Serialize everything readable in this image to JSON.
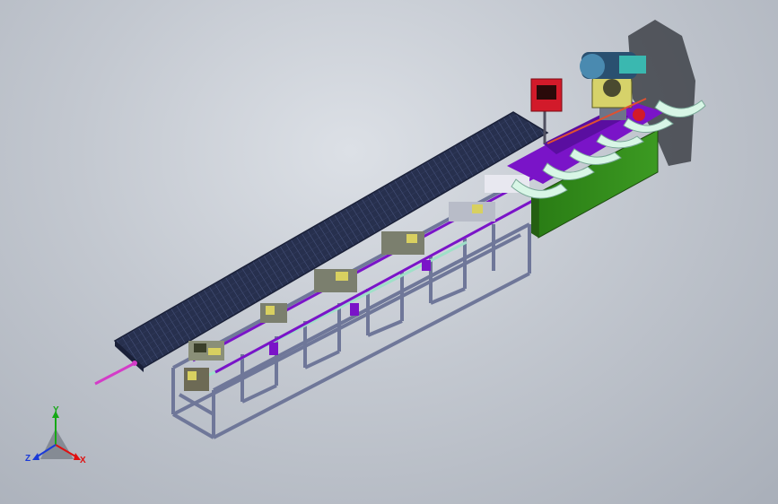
{
  "viewport": {
    "name": "cad-3d-viewport"
  },
  "model": {
    "description_hidden": ""
  },
  "triad": {
    "y_label": "Y",
    "z_label": "Z",
    "x_label": "X",
    "colors": {
      "x": "#e01010",
      "y": "#16a816",
      "z": "#1a3ad8"
    }
  },
  "colors": {
    "conveyor": "#26304f",
    "frame": "#7c83a6",
    "purple": "#7a14c8",
    "green_cabinet": "#2f8a18",
    "control_panel": "#d21a2a",
    "guard": "#d8f6e6"
  }
}
